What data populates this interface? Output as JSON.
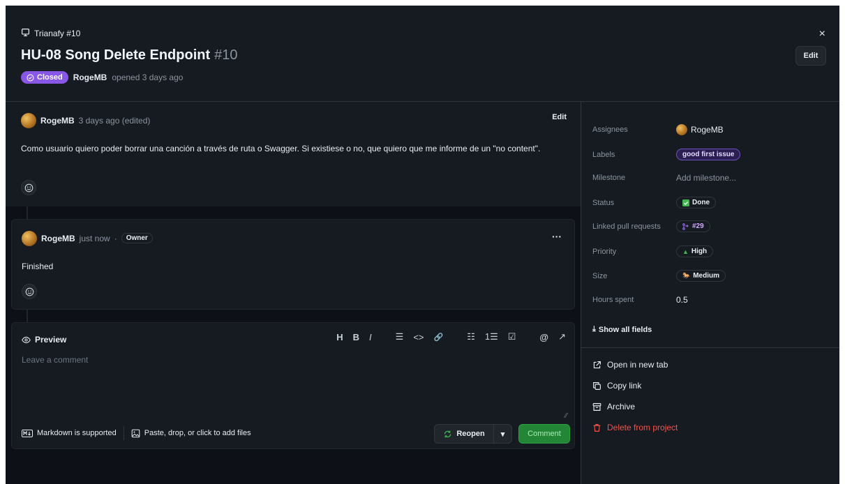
{
  "header": {
    "project": "Trianafy #10",
    "title": "HU-08 Song Delete Endpoint",
    "number": "#10",
    "status": "Closed",
    "author": "RogeMB",
    "opened_text": "opened 3 days ago",
    "close_glyph": "×",
    "edit_label": "Edit"
  },
  "comments": [
    {
      "author": "RogeMB",
      "time": "3 days ago (edited)",
      "edit_label": "Edit",
      "body": "Como usuario quiero poder borrar una canción a través de ruta o Swagger. Si existiese o no, que quiero que me informe de un \"no content\"."
    },
    {
      "author": "RogeMB",
      "time": "just now",
      "dot": "·",
      "badge": "Owner",
      "menu": "···",
      "body": "Finished"
    }
  ],
  "editor": {
    "preview_label": "Preview",
    "placeholder": "Leave a comment",
    "toolbar": [
      "H",
      "B",
      "I",
      "☰",
      "<>",
      "🔗",
      "☷",
      "1☰",
      "☑",
      "@",
      "↗"
    ],
    "markdown_note": "Markdown is supported",
    "files_note": "Paste, drop, or click to add files",
    "reopen_label": "Reopen",
    "comment_label": "Comment"
  },
  "sidebar": {
    "fields": [
      {
        "key": "Assignees",
        "value": "RogeMB"
      },
      {
        "key": "Labels",
        "value": "good first issue"
      },
      {
        "key": "Milestone",
        "value": "Add milestone..."
      },
      {
        "key": "Status",
        "value": "Done"
      },
      {
        "key": "Linked pull requests",
        "value": "#29"
      },
      {
        "key": "Priority",
        "value": "High"
      },
      {
        "key": "Size",
        "value": "Medium"
      },
      {
        "key": "Hours spent",
        "value": "0.5"
      }
    ],
    "show_all": "Show all fields",
    "actions": {
      "open_tab": "Open in new tab",
      "copy_link": "Copy link",
      "archive": "Archive",
      "delete": "Delete from project"
    }
  },
  "colors": {
    "closed": "#8957e5",
    "comment_button": "#238636",
    "danger": "#f85149"
  }
}
